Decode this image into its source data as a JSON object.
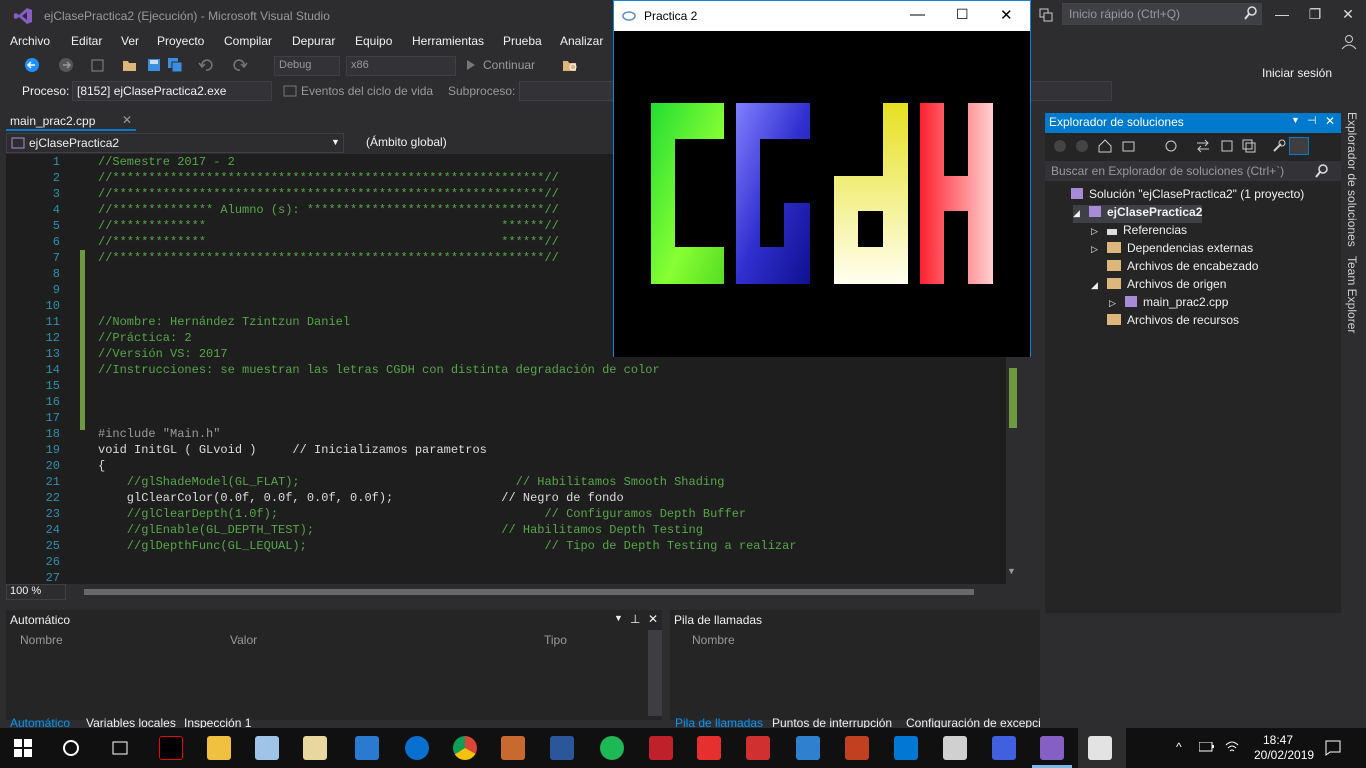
{
  "window": {
    "title": "ejClasePractica2 (Ejecución) - Microsoft Visual Studio",
    "quick_launch": "Inicio rápido (Ctrl+Q)",
    "sign_in": "Iniciar sesión"
  },
  "menu": [
    "Archivo",
    "Editar",
    "Ver",
    "Proyecto",
    "Compilar",
    "Depurar",
    "Equipo",
    "Herramientas",
    "Prueba",
    "Analizar"
  ],
  "toolbar": {
    "config": "Debug",
    "platform": "x86",
    "continue": "Continuar"
  },
  "debug_toolbar": {
    "process_label": "Proceso:",
    "process_value": "[8152] ejClasePractica2.exe",
    "lifecycle": "Eventos del ciclo de vida",
    "subprocess": "Subproceso:"
  },
  "editor": {
    "tab": "main_prac2.cpp",
    "project_dropdown": "ejClasePractica2",
    "scope_dropdown": "(Ámbito global)",
    "zoom": "100 %",
    "lines": [
      {
        "n": "1",
        "text": "//Semestre 2017 - 2",
        "cls": "cmt"
      },
      {
        "n": "2",
        "text": "//************************************************************//",
        "cls": "cmt"
      },
      {
        "n": "3",
        "text": "//************************************************************//",
        "cls": "cmt"
      },
      {
        "n": "4",
        "text": "//************** Alumno (s): *********************************//",
        "cls": "cmt"
      },
      {
        "n": "5",
        "text": "//*************                                         ******//",
        "cls": "cmt"
      },
      {
        "n": "6",
        "text": "//*************                                         ******//",
        "cls": "cmt"
      },
      {
        "n": "7",
        "text": "//************************************************************//",
        "cls": "cmt"
      },
      {
        "n": "8",
        "text": "",
        "cls": "cmt"
      },
      {
        "n": "9",
        "text": "",
        "cls": "cmt"
      },
      {
        "n": "10",
        "text": "",
        "cls": "cmt"
      },
      {
        "n": "11",
        "text": "//Nombre: Hernández Tzintzun Daniel",
        "cls": "cmt"
      },
      {
        "n": "12",
        "text": "//Práctica: 2",
        "cls": "cmt"
      },
      {
        "n": "13",
        "text": "//Versión VS: 2017",
        "cls": "cmt"
      },
      {
        "n": "14",
        "text": "//Instrucciones: se muestran las letras CGDH con distinta degradación de color",
        "cls": "cmt"
      },
      {
        "n": "15",
        "text": "",
        "cls": "cmt"
      },
      {
        "n": "16",
        "text": "",
        "cls": "cmt"
      },
      {
        "n": "17",
        "text": "",
        "cls": "cmt"
      },
      {
        "n": "18",
        "text": "#include \"Main.h\"",
        "cls": "inc"
      },
      {
        "n": "19",
        "text": "void InitGL ( GLvoid )     // Inicializamos parametros",
        "cls": "mix19"
      },
      {
        "n": "20",
        "text": "{",
        "cls": "plain"
      },
      {
        "n": "21",
        "text": "    //glShadeModel(GL_FLAT);                              // Habilitamos Smooth Shading",
        "cls": "cmt"
      },
      {
        "n": "22",
        "text": "    glClearColor(0.0f, 0.0f, 0.0f, 0.0f);               // Negro de fondo",
        "cls": "mix22"
      },
      {
        "n": "23",
        "text": "    //glClearDepth(1.0f);                                     // Configuramos Depth Buffer",
        "cls": "cmt"
      },
      {
        "n": "24",
        "text": "    //glEnable(GL_DEPTH_TEST);                          // Habilitamos Depth Testing",
        "cls": "cmt"
      },
      {
        "n": "25",
        "text": "    //glDepthFunc(GL_LEQUAL);                                 // Tipo de Depth Testing a realizar",
        "cls": "cmt"
      },
      {
        "n": "26",
        "text": "",
        "cls": "plain"
      },
      {
        "n": "27",
        "text": "",
        "cls": "plain"
      }
    ]
  },
  "gl_window": {
    "title": "Practica 2"
  },
  "solution_explorer": {
    "title": "Explorador de soluciones",
    "search_placeholder": "Buscar en Explorador de soluciones (Ctrl+`)",
    "items": [
      {
        "label": "Solución \"ejClasePractica2\"  (1 proyecto)",
        "level": 0,
        "arrow": "",
        "bold": false
      },
      {
        "label": "ejClasePractica2",
        "level": 1,
        "arrow": "◢",
        "bold": true
      },
      {
        "label": "Referencias",
        "level": 2,
        "arrow": "▷",
        "bold": false
      },
      {
        "label": "Dependencias externas",
        "level": 2,
        "arrow": "▷",
        "bold": false
      },
      {
        "label": "Archivos de encabezado",
        "level": 2,
        "arrow": "",
        "bold": false
      },
      {
        "label": "Archivos de origen",
        "level": 2,
        "arrow": "◢",
        "bold": false
      },
      {
        "label": "main_prac2.cpp",
        "level": 3,
        "arrow": "▷",
        "bold": false
      },
      {
        "label": "Archivos de recursos",
        "level": 2,
        "arrow": "",
        "bold": false
      }
    ],
    "side_tabs": [
      "Explorador de soluciones",
      "Team Explorer"
    ]
  },
  "auto_panel": {
    "title": "Automático",
    "columns": [
      "Nombre",
      "Valor",
      "Tipo"
    ],
    "tabs": [
      "Automático",
      "Variables locales",
      "Inspección 1"
    ]
  },
  "stack_panel": {
    "title": "Pila de llamadas",
    "columns": [
      "Nombre"
    ],
    "tabs": [
      "Pila de llamadas",
      "Puntos de interrupción",
      "Configuración de excepci"
    ]
  },
  "taskbar": {
    "time": "18:47",
    "date": "20/02/2019"
  }
}
